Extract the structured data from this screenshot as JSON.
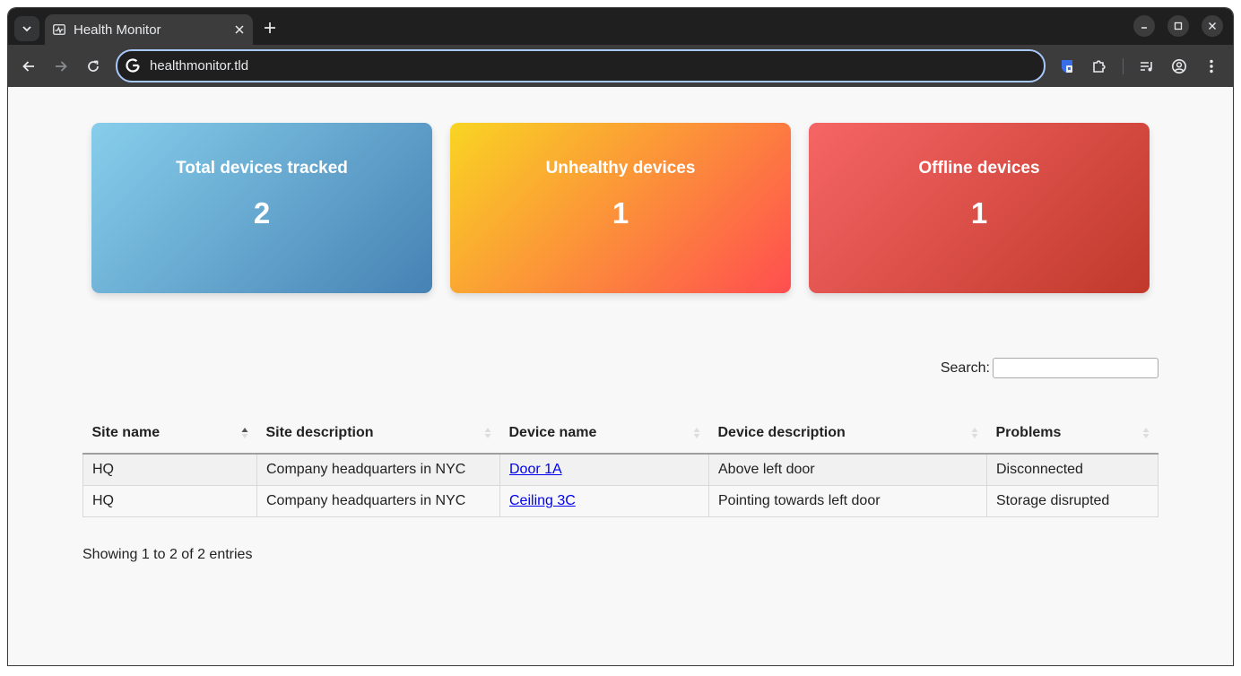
{
  "browser": {
    "tab_title": "Health Monitor",
    "url": "healthmonitor.tld"
  },
  "cards": [
    {
      "title": "Total devices tracked",
      "value": "2",
      "color_from": "#87ceeb",
      "color_to": "#4682b4"
    },
    {
      "title": "Unhealthy devices",
      "value": "1",
      "color_from": "#f9d423",
      "color_to": "#ff4e50"
    },
    {
      "title": "Offline devices",
      "value": "1",
      "color_from": "#f56565",
      "color_to": "#c0392b"
    }
  ],
  "search": {
    "label": "Search:",
    "value": ""
  },
  "table": {
    "headers": [
      "Site name",
      "Site description",
      "Device name",
      "Device description",
      "Problems"
    ],
    "sorted_column": "Site name",
    "rows": [
      [
        "HQ",
        "Company headquarters in NYC",
        "Door 1A",
        "Above left door",
        "Disconnected"
      ],
      [
        "HQ",
        "Company headquarters in NYC",
        "Ceiling 3C",
        "Pointing towards left door",
        "Storage disrupted"
      ]
    ]
  },
  "info": "Showing 1 to 2 of 2 entries"
}
